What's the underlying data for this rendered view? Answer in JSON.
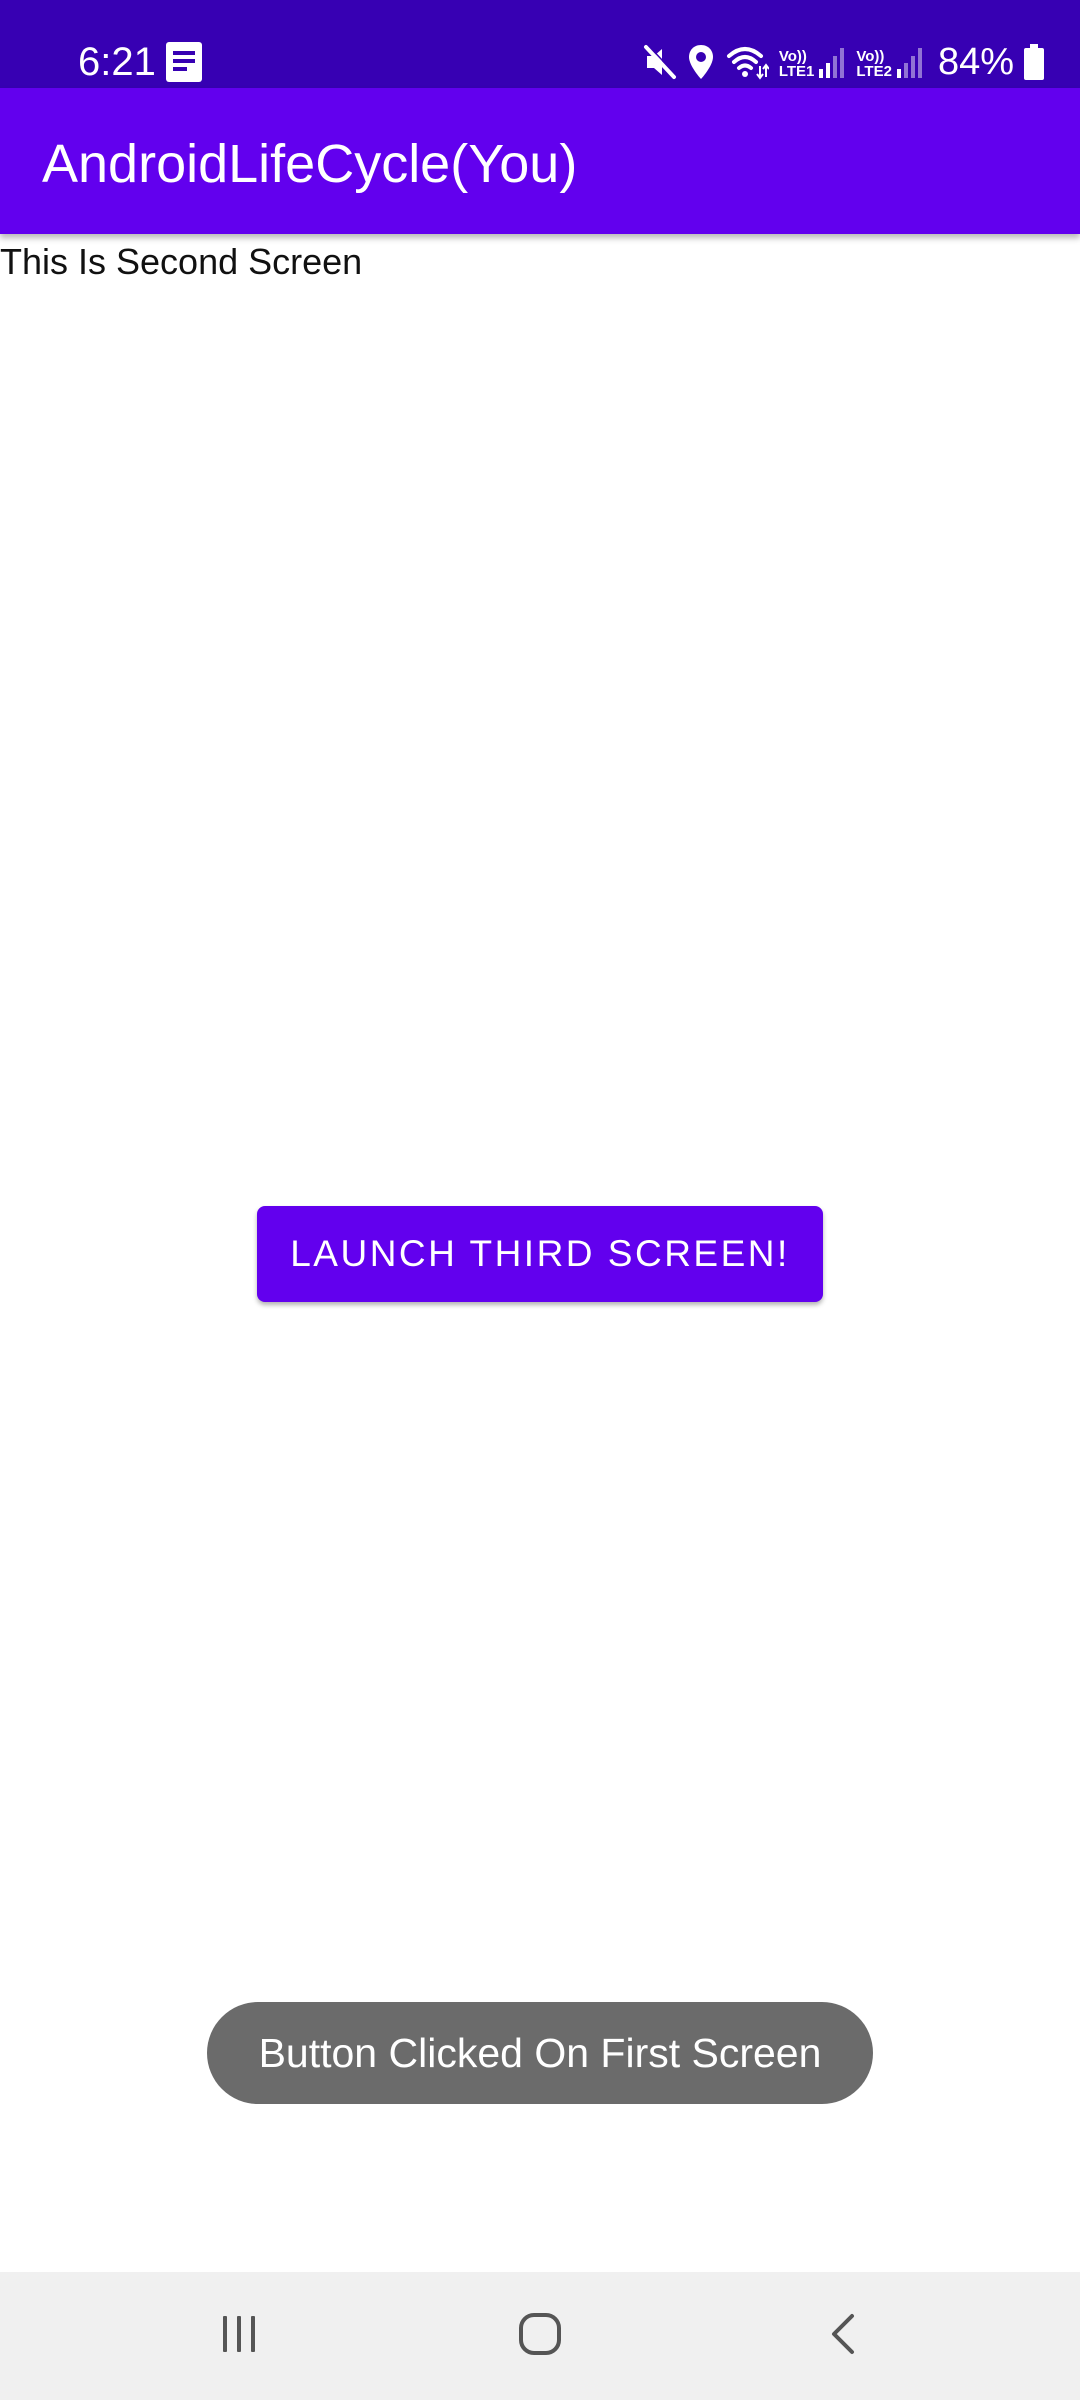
{
  "status_bar": {
    "time": "6:21",
    "battery_percent": "84%",
    "sim1_label": "LTE1",
    "sim2_label": "LTE2",
    "volte_label": "Vo))",
    "icons": [
      "notification-doc-icon",
      "mute-icon",
      "location-icon",
      "wifi-icon",
      "signal-icon",
      "battery-icon"
    ],
    "background_color": "#3700B3"
  },
  "app_bar": {
    "title": "AndroidLifeCycle(You)",
    "background_color": "#6200EE"
  },
  "content": {
    "screen_label": "This Is Second Screen",
    "launch_button_label": "LAUNCH THIRD SCREEN!"
  },
  "toast": {
    "message": "Button Clicked On First Screen"
  },
  "nav_bar": {
    "icons": [
      "recents-icon",
      "home-icon",
      "back-icon"
    ]
  }
}
